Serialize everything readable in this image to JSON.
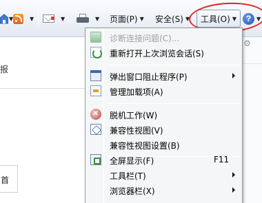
{
  "commandbar": {
    "page_label": "页面(P)",
    "safety_label": "安全(S)",
    "tools_label": "工具(O)",
    "drop_glyph": "▼",
    "help_glyph": "?"
  },
  "page": {
    "partial_left_text": "报",
    "partial_box_text": "首",
    "right_icon": "⚙"
  },
  "menu": {
    "items": [
      {
        "label": "诊断连接问题(C)...",
        "shortcut": "",
        "submenu": false,
        "disabled": true,
        "icon": "diagnose-icon"
      },
      {
        "label": "重新打开上次浏览会话(S)",
        "shortcut": "",
        "submenu": false,
        "disabled": false,
        "icon": "reopen-session-icon"
      },
      {
        "label": "弹出窗口阻止程序(P)",
        "shortcut": "",
        "submenu": true,
        "disabled": false,
        "icon": "popup-blocker-icon"
      },
      {
        "label": "管理加载项(A)",
        "shortcut": "",
        "submenu": false,
        "disabled": false,
        "icon": "addons-icon"
      },
      {
        "label": "脱机工作(W)",
        "shortcut": "",
        "submenu": false,
        "disabled": false,
        "icon": "offline-icon"
      },
      {
        "label": "兼容性视图(V)",
        "shortcut": "",
        "submenu": false,
        "disabled": false,
        "icon": "compat-view-icon"
      },
      {
        "label": "兼容性视图设置(B)",
        "shortcut": "",
        "submenu": false,
        "disabled": false,
        "icon": ""
      },
      {
        "label": "全屏显示(F)",
        "shortcut": "F11",
        "submenu": false,
        "disabled": false,
        "icon": "fullscreen-icon"
      },
      {
        "label": "工具栏(T)",
        "shortcut": "",
        "submenu": true,
        "disabled": false,
        "icon": ""
      },
      {
        "label": "浏览器栏(X)",
        "shortcut": "",
        "submenu": true,
        "disabled": false,
        "icon": ""
      }
    ]
  },
  "colors": {
    "annotation_circle": "#e02525",
    "menu_bg": "#f5f6f7",
    "disabled_text": "#9aa0a6"
  }
}
